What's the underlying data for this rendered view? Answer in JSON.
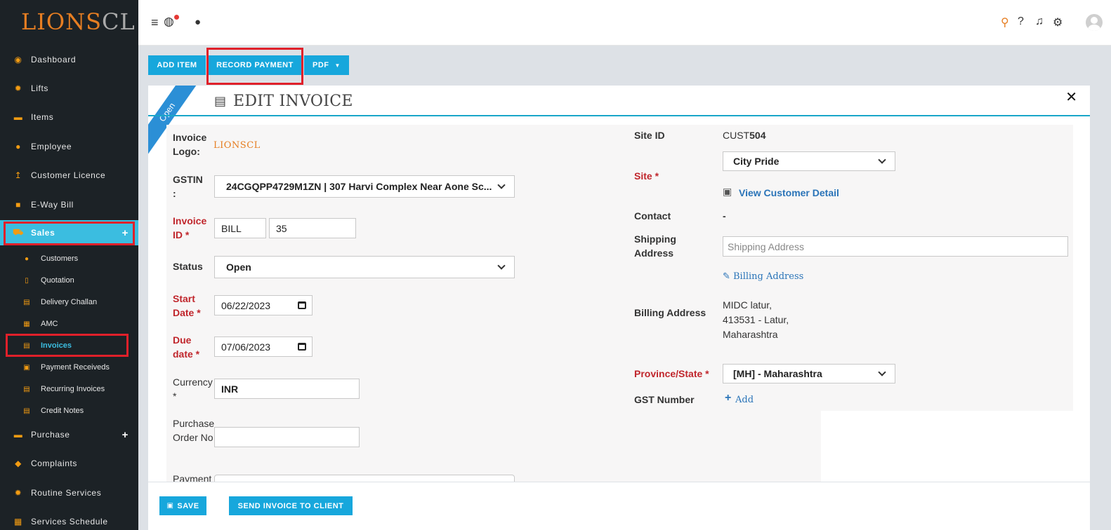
{
  "app": {
    "logo_main": "LIONS",
    "logo_tail": "CL"
  },
  "sidebar": {
    "items": [
      {
        "label": "Dashboard",
        "icon": "dashboard-icon"
      },
      {
        "label": "Lifts",
        "icon": "gear-icon"
      },
      {
        "label": "Items",
        "icon": "box-icon"
      },
      {
        "label": "Employee",
        "icon": "user-icon"
      },
      {
        "label": "Customer Licence",
        "icon": "arrow-up-icon"
      },
      {
        "label": "E-Way Bill",
        "icon": "truck-icon"
      },
      {
        "label": "Sales",
        "icon": "cart-icon"
      },
      {
        "label": "Purchase",
        "icon": "box-icon"
      },
      {
        "label": "Complaints",
        "icon": "tag-icon"
      },
      {
        "label": "Routine Services",
        "icon": "gears-icon"
      },
      {
        "label": "Services Schedule",
        "icon": "grid-icon"
      }
    ],
    "sales_sub": [
      {
        "label": "Customers"
      },
      {
        "label": "Quotation"
      },
      {
        "label": "Delivery Challan"
      },
      {
        "label": "AMC"
      },
      {
        "label": "Invoices"
      },
      {
        "label": "Payment Receiveds"
      },
      {
        "label": "Recurring Invoices"
      },
      {
        "label": "Credit Notes"
      }
    ]
  },
  "toolbar": {
    "add_item": "ADD ITEM",
    "record_payment": "RECORD PAYMENT",
    "pdf": "PDF"
  },
  "panel": {
    "title": "EDIT INVOICE",
    "ribbon": "Open"
  },
  "form_left": {
    "invoice_logo_label": "Invoice Logo:",
    "invoice_logo_text": "LIONSCL",
    "gstin_label": "GSTIN :",
    "gstin_value": "24CGQPP4729M1ZN | 307 Harvi Complex Near Aone Sc...",
    "invoice_id_label": "Invoice ID *",
    "invoice_prefix": "BILL",
    "invoice_number": "35",
    "status_label": "Status",
    "status_value": "Open",
    "start_date_label": "Start Date *",
    "start_date_value": "06/22/2023",
    "due_date_label": "Due date *",
    "due_date_value": "07/06/2023",
    "currency_label": "Currency *",
    "currency_value": "INR",
    "po_label": "Purchase Order No",
    "po_value": "",
    "payment_label": "Payment"
  },
  "form_right": {
    "site_id_label": "Site ID",
    "site_id_prefix": "CUST",
    "site_id_number": "504",
    "site_label": "Site *",
    "site_value": "City Pride",
    "view_customer": "View Customer Detail",
    "contact_label": "Contact",
    "contact_value": "-",
    "shipping_label": "Shipping Address",
    "shipping_placeholder": "Shipping Address",
    "billing_link": "Billing Address",
    "billing_label": "Billing Address",
    "billing_line1": "MIDC latur,",
    "billing_line2": "413531 - Latur,",
    "billing_line3": "Maharashtra",
    "province_label": "Province/State *",
    "province_value": "[MH] - Maharashtra",
    "gst_label": "GST Number",
    "gst_add": "Add"
  },
  "footer": {
    "save": "SAVE",
    "send": "SEND INVOICE TO CLIENT"
  },
  "colors": {
    "accent": "#17a7dc",
    "sidebar_bg": "#1c2226",
    "required": "#c0262c",
    "highlight_box": "#e0202a"
  }
}
